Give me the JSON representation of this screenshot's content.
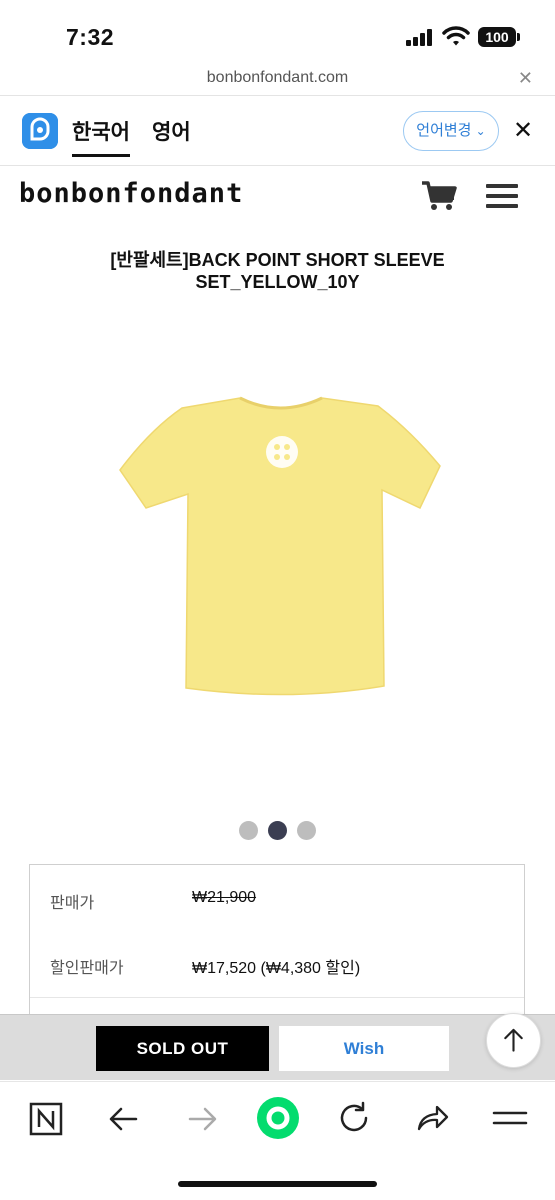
{
  "status_bar": {
    "time": "7:32",
    "battery": "100"
  },
  "url_bar": {
    "url": "bonbonfondant.com",
    "close_icon": "close-icon"
  },
  "translate_bar": {
    "tabs": [
      "한국어",
      "영어"
    ],
    "active_tab": "한국어",
    "lang_change_label": "언어변경",
    "accent_color": "#2f8fe8"
  },
  "site": {
    "logo": "bonbonfondant"
  },
  "product": {
    "title_line1": "[반팔세트]BACK POINT SHORT SLEEVE",
    "title_line2": "SET_YELLOW_10Y",
    "image_colors": {
      "shirt": "#f7e88a",
      "emblem": "#ffffff"
    },
    "carousel": {
      "count": 3,
      "active_index": 1
    }
  },
  "price": {
    "sale_label": "판매가",
    "sale_value": "₩21,900",
    "discount_label": "할인판매가",
    "discount_value": "₩17,520 (₩4,380 할인)"
  },
  "actions": {
    "sold_out_label": "SOLD OUT",
    "wish_label": "Wish"
  },
  "browser_toolbar": {
    "icons": [
      "naver-n-icon",
      "back-arrow-icon",
      "forward-arrow-icon",
      "home-green-icon",
      "reload-icon",
      "share-icon",
      "menu-icon"
    ]
  }
}
